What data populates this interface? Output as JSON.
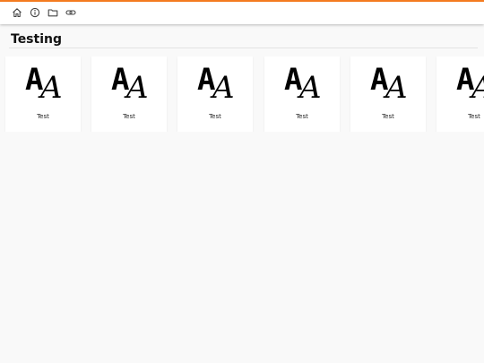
{
  "toolbar": {
    "icons": [
      "home-icon",
      "info-icon",
      "folder-icon",
      "link-icon"
    ]
  },
  "page": {
    "title": "Testing"
  },
  "cards": [
    {
      "label": "Test",
      "glyph": "A",
      "glyph_alt": "A"
    },
    {
      "label": "Test",
      "glyph": "A",
      "glyph_alt": "A"
    },
    {
      "label": "Test",
      "glyph": "A",
      "glyph_alt": "A"
    },
    {
      "label": "Test",
      "glyph": "A",
      "glyph_alt": "A"
    },
    {
      "label": "Test",
      "glyph": "A",
      "glyph_alt": "A"
    },
    {
      "label": "Test",
      "glyph": "A",
      "glyph_alt": "A"
    }
  ],
  "colors": {
    "accent": "#f47b20",
    "background": "#f9f9f9",
    "card": "#ffffff"
  }
}
